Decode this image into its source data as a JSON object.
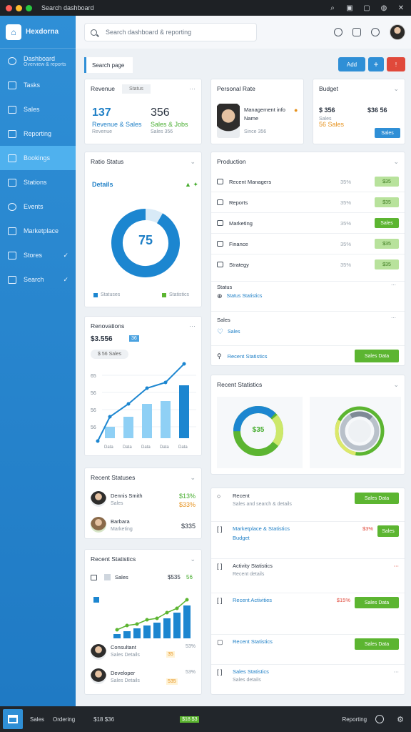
{
  "window": {
    "title": "Search dashboard"
  },
  "brand": {
    "name": "Hexdorna"
  },
  "sidebar": {
    "items": [
      {
        "label": "Dashboard",
        "sub": "Overview & reports",
        "icon": "globe-icon"
      },
      {
        "label": "Tasks",
        "icon": "list-icon"
      },
      {
        "label": "Sales",
        "icon": "chart-icon"
      },
      {
        "label": "Reporting",
        "icon": "window-icon"
      },
      {
        "label": "Bookings",
        "icon": "calendar-icon",
        "active": true
      },
      {
        "label": "Stations",
        "icon": "book-icon"
      },
      {
        "label": "Events",
        "icon": "chat-icon"
      },
      {
        "label": "Marketplace",
        "icon": "home-icon"
      },
      {
        "label": "Stores",
        "icon": "book-icon",
        "check": "✓"
      },
      {
        "label": "Search",
        "icon": "list-icon",
        "check": "✓"
      }
    ]
  },
  "header": {
    "search_placeholder": "Search dashboard & reporting"
  },
  "toolbar": {
    "page_title": "Search page",
    "btn_primary": "Add",
    "btn_plus": "+",
    "btn_alert": "!"
  },
  "kpi": {
    "title": "Revenue",
    "tag": "Status",
    "v1": "137",
    "v1_sub": "Revenue & Sales",
    "v2": "356",
    "v2_sub": "Sales & Jobs",
    "v2_sub2": "Sales 356"
  },
  "profile": {
    "title": "Personal Rate",
    "name": "Management info",
    "role": "Name",
    "meta": "Since 356"
  },
  "budget": {
    "title": "Budget",
    "v1": "$ 356",
    "v2": "$36 56",
    "sub": "Sales",
    "status": "56 Sales",
    "action": "Sales"
  },
  "donut_card": {
    "title": "Ratio Status",
    "subtitle": "Details",
    "center": "75",
    "legend1": "Statuses",
    "legend2": "Statistics"
  },
  "list_card": {
    "title": "Production",
    "rows": [
      {
        "label": "Recent Managers",
        "pct": "35%",
        "btn": "$35"
      },
      {
        "label": "Reports",
        "pct": "35%",
        "btn": "$35"
      },
      {
        "label": "Marketing",
        "pct": "35%",
        "btn": "Sales"
      },
      {
        "label": "Finance",
        "pct": "35%",
        "btn": "$35"
      },
      {
        "label": "Strategy",
        "pct": "35%",
        "btn": "$35"
      }
    ],
    "extra1_title": "Status",
    "extra1_sub": "Status Statistics",
    "extra2_title": "Sales",
    "extra2_sub": "Sales",
    "footer_label": "Recent Statistics",
    "footer_btn": "Sales Data"
  },
  "bar_card": {
    "title": "Renovations",
    "amount": "$3.556",
    "badge": "36",
    "pill": "$ 56 Sales",
    "yticks": [
      "65",
      "56",
      "56",
      "56"
    ],
    "xticks": [
      "Data",
      "Data",
      "Data",
      "Data",
      "Data"
    ]
  },
  "team_card": {
    "title": "Recent Statuses",
    "people": [
      {
        "name": "Dennis Smith",
        "sub": "Sales",
        "v1": "$13%",
        "v2": "$33%"
      },
      {
        "name": "Barbara",
        "sub": "Marketing",
        "v": "$335"
      }
    ]
  },
  "perf_card": {
    "title": "Recent Statistics",
    "label": "Sales",
    "amount": "$535",
    "badge": "56",
    "people": [
      {
        "name": "Consultant",
        "sub": "Sales Details",
        "v": "35",
        "pct": "53%"
      },
      {
        "name": "Developer",
        "sub": "Sales Details",
        "v": "535",
        "pct": "53%"
      }
    ]
  },
  "donuts_card": {
    "title": "Recent Statistics",
    "center": "$35"
  },
  "activity_card": {
    "rows": [
      {
        "title": "Recent",
        "sub": "Sales and search & details",
        "btn": "Sales Data",
        "icon": "circle-icon"
      },
      {
        "title": "Marketplace & Statistics",
        "sub": "Budget",
        "pct": "$3%",
        "btn": "Sales",
        "icon": "bracket-icon"
      },
      {
        "title": "Activity Statistics",
        "sub": "Recent details",
        "icon": "bracket-icon"
      },
      {
        "title": "Recent Activities",
        "sub": "",
        "pct": "$15%",
        "btn": "Sales Data",
        "icon": "bracket-icon"
      },
      {
        "title": "Recent Statistics",
        "sub": "",
        "btn": "Sales Data",
        "icon": "square-icon"
      },
      {
        "title": "Sales Statistics",
        "sub": "Sales details",
        "icon": "bracket-icon"
      }
    ]
  },
  "bottom": {
    "app1": "Sales",
    "app2": "Ordering",
    "sum": "$18 $36",
    "badge": "$18 $3",
    "right": "Reporting"
  },
  "colors": {
    "primary": "#2f8fd6",
    "sidebar_active": "#4fb1ee",
    "green": "#5cb531",
    "red": "#e0493b"
  }
}
